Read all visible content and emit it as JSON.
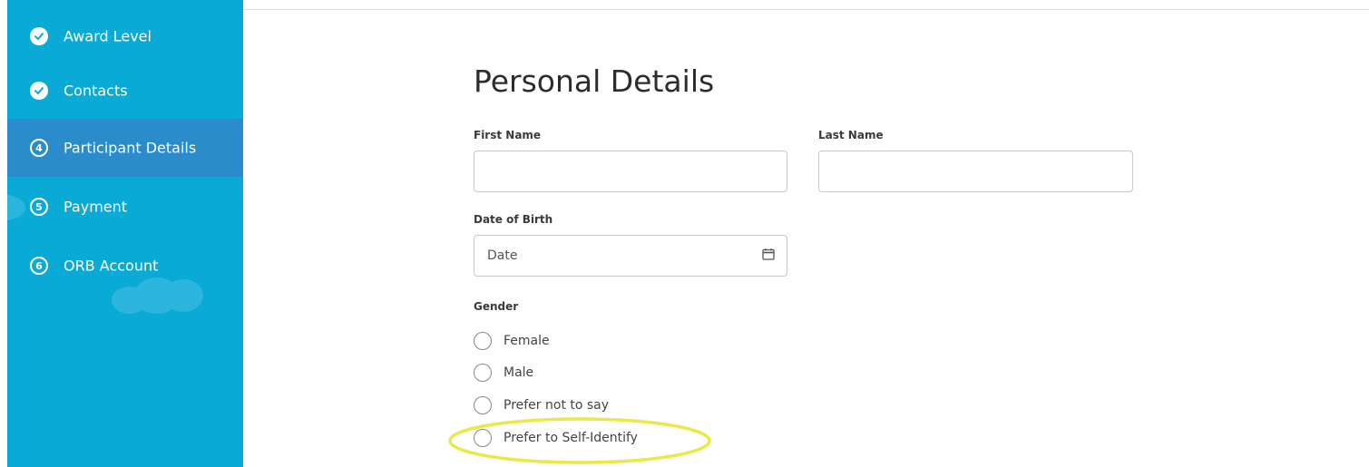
{
  "sidebar": {
    "steps": [
      {
        "label": "Award Level",
        "status": "complete",
        "icon": "check-icon"
      },
      {
        "label": "Contacts",
        "status": "complete",
        "icon": "check-icon"
      },
      {
        "label": "Participant Details",
        "status": "active",
        "number": "4"
      },
      {
        "label": "Payment",
        "status": "pending",
        "number": "5"
      },
      {
        "label": "ORB Account",
        "status": "pending",
        "number": "6"
      }
    ],
    "colors": {
      "background": "#0aaad6",
      "active": "#2a8ccb"
    }
  },
  "form": {
    "title": "Personal Details",
    "first_name": {
      "label": "First Name",
      "value": ""
    },
    "last_name": {
      "label": "Last Name",
      "value": ""
    },
    "dob": {
      "label": "Date of Birth",
      "placeholder": "Date",
      "icon": "calendar-icon"
    },
    "gender": {
      "label": "Gender",
      "options": [
        {
          "label": "Female",
          "selected": false
        },
        {
          "label": "Male",
          "selected": false
        },
        {
          "label": "Prefer not to say",
          "selected": false
        },
        {
          "label": "Prefer to Self-Identify",
          "selected": false,
          "highlighted": true
        }
      ]
    }
  },
  "colors": {
    "highlight": "#e8ea4a"
  }
}
